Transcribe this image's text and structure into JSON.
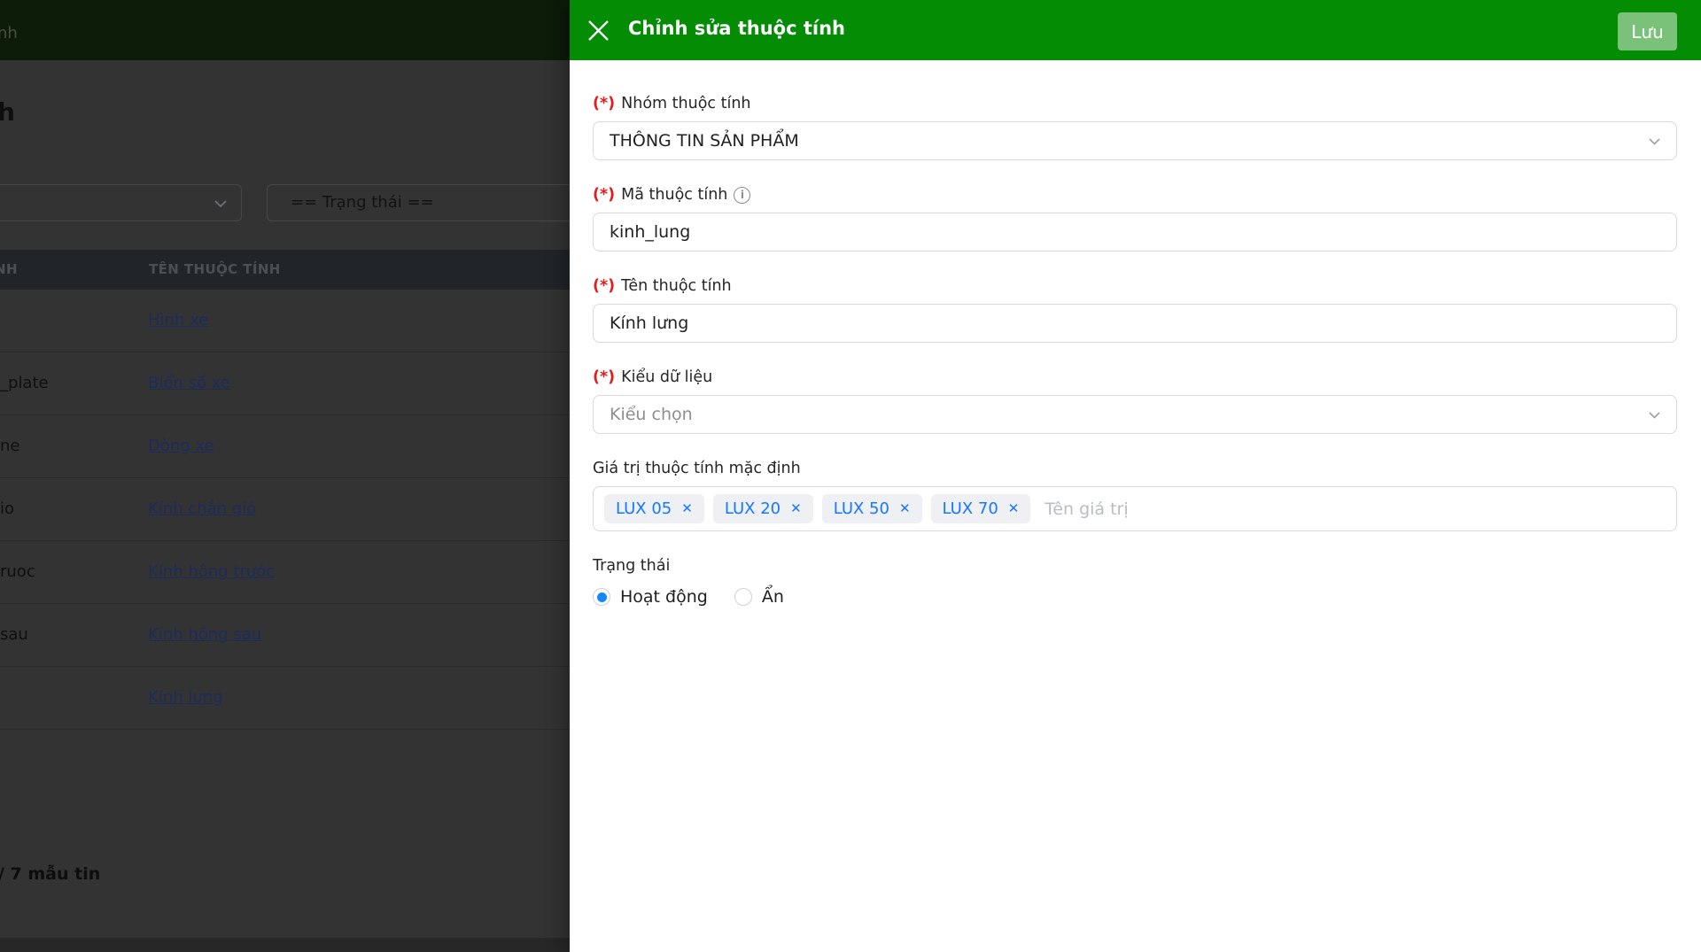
{
  "overlay_page": {
    "topbar": {
      "breadcrumb_fragment": "nh"
    },
    "heading_fragment": "h",
    "filters": {
      "status_filter": "== Trạng thái =="
    },
    "table": {
      "columns": [
        {
          "label_fragment": "NH"
        },
        {
          "label": "TÊN THUỘC TÍNH"
        }
      ],
      "rows": [
        {
          "code_fragment": "",
          "name": "Hình xe"
        },
        {
          "code_fragment": "_plate",
          "name": "Biển số xe"
        },
        {
          "code_fragment": "ne",
          "name": "Dòng xe"
        },
        {
          "code_fragment": "io",
          "name": "Kính chắn gió"
        },
        {
          "code_fragment": "ruoc",
          "name": "Kính hông trước"
        },
        {
          "code_fragment": "sau",
          "name": "Kính hông sau"
        },
        {
          "code_fragment": "",
          "name": "Kính lưng"
        }
      ]
    },
    "footer": {
      "record_count_fragment": "/ 7 mẫu tin"
    }
  },
  "drawer": {
    "title": "Chỉnh sửa thuộc tính",
    "save_label": "Lưu",
    "fields": {
      "group": {
        "required": "(*)",
        "label": "Nhóm thuộc tính",
        "value": "THÔNG TIN SẢN PHẨM"
      },
      "code": {
        "required": "(*)",
        "label": "Mã thuộc tính",
        "info_icon": "info-circle",
        "value": "kinh_lung"
      },
      "name": {
        "required": "(*)",
        "label": "Tên thuộc tính",
        "value": "Kính lưng"
      },
      "datatype": {
        "required": "(*)",
        "label": "Kiểu dữ liệu",
        "placeholder": "Kiểu chọn"
      },
      "default_values": {
        "label": "Giá trị thuộc tính mặc định",
        "tags": [
          "LUX 05",
          "LUX 20",
          "LUX 50",
          "LUX 70"
        ],
        "input_placeholder": "Tên giá trị"
      },
      "status": {
        "label": "Trạng thái",
        "options": [
          {
            "label": "Hoạt động",
            "selected": true
          },
          {
            "label": "Ẩn",
            "selected": false
          }
        ]
      }
    }
  },
  "colors": {
    "header_green": "#048c04",
    "save_button_bg": "rgba(255,255,255,0.47)",
    "tag_blue": "#1677ff",
    "radio_blue": "#1788fa",
    "required_red": "#e31b1b",
    "link_navy": "#1c2b5a",
    "overlay_bg": "#333333"
  }
}
